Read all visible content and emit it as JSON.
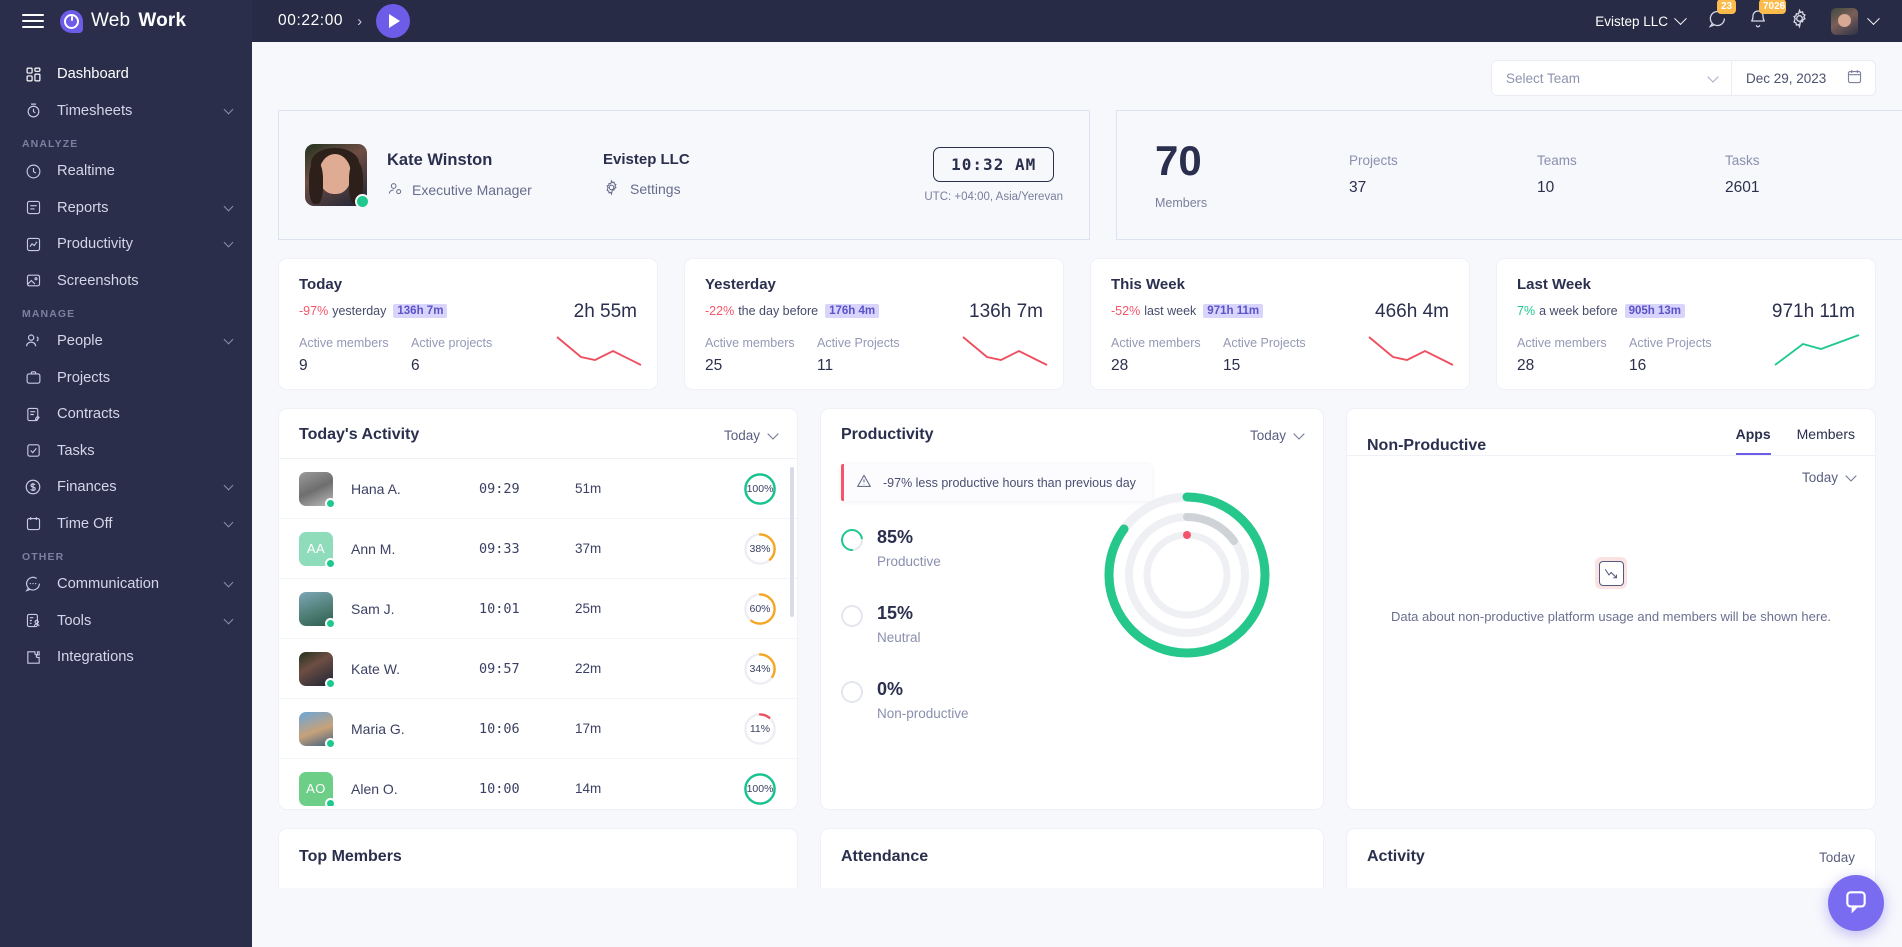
{
  "topbar": {
    "brand_light": "Web",
    "brand_bold": "Work",
    "timer": "00:22:00",
    "arrow": "›",
    "org": "Evistep LLC",
    "chat_badge": "23",
    "bell_badge": "7026"
  },
  "sidebar": {
    "items": [
      {
        "label": "Dashboard",
        "icon": "dashboard-icon",
        "active": true,
        "expandable": false
      },
      {
        "label": "Timesheets",
        "icon": "timesheets-icon",
        "active": false,
        "expandable": true
      },
      {
        "section": "ANALYZE"
      },
      {
        "label": "Realtime",
        "icon": "realtime-icon",
        "active": false,
        "expandable": false
      },
      {
        "label": "Reports",
        "icon": "reports-icon",
        "active": false,
        "expandable": true
      },
      {
        "label": "Productivity",
        "icon": "productivity-icon",
        "active": false,
        "expandable": true
      },
      {
        "label": "Screenshots",
        "icon": "screenshots-icon",
        "active": false,
        "expandable": false
      },
      {
        "section": "MANAGE"
      },
      {
        "label": "People",
        "icon": "people-icon",
        "active": false,
        "expandable": true
      },
      {
        "label": "Projects",
        "icon": "projects-icon",
        "active": false,
        "expandable": false
      },
      {
        "label": "Contracts",
        "icon": "contracts-icon",
        "active": false,
        "expandable": false
      },
      {
        "label": "Tasks",
        "icon": "tasks-icon",
        "active": false,
        "expandable": false
      },
      {
        "label": "Finances",
        "icon": "finances-icon",
        "active": false,
        "expandable": true
      },
      {
        "label": "Time Off",
        "icon": "timeoff-icon",
        "active": false,
        "expandable": true
      },
      {
        "section": "OTHER"
      },
      {
        "label": "Communication",
        "icon": "communication-icon",
        "active": false,
        "expandable": true
      },
      {
        "label": "Tools",
        "icon": "tools-icon",
        "active": false,
        "expandable": true
      },
      {
        "label": "Integrations",
        "icon": "integrations-icon",
        "active": false,
        "expandable": false
      }
    ]
  },
  "filters": {
    "team_placeholder": "Select Team",
    "date": "Dec 29, 2023"
  },
  "profile": {
    "name": "Kate Winston",
    "role": "Executive Manager",
    "org": "Evistep LLC",
    "settings": "Settings",
    "clock": "10:32 AM",
    "timezone": "UTC: +04:00, Asia/Yerevan"
  },
  "stats": {
    "members_value": "70",
    "members_label": "Members",
    "items": [
      {
        "label": "Projects",
        "value": "37"
      },
      {
        "label": "Teams",
        "value": "10"
      },
      {
        "label": "Tasks",
        "value": "2601"
      }
    ]
  },
  "mini_cards": [
    {
      "title": "Today",
      "delta": "-97%",
      "delta_sign": "neg",
      "compare": "yesterday",
      "pill": "136h 7m",
      "total": "2h 55m",
      "members_label": "Active members",
      "members_value": "9",
      "projects_label": "Active projects",
      "projects_value": "6",
      "trend": "down",
      "trend_color": "#ED4F5E"
    },
    {
      "title": "Yesterday",
      "delta": "-22%",
      "delta_sign": "neg",
      "compare": "the day before",
      "pill": "176h 4m",
      "total": "136h 7m",
      "members_label": "Active members",
      "members_value": "25",
      "projects_label": "Active Projects",
      "projects_value": "11",
      "trend": "down",
      "trend_color": "#ED4F5E"
    },
    {
      "title": "This Week",
      "delta": "-52%",
      "delta_sign": "neg",
      "compare": "last week",
      "pill": "971h 11m",
      "total": "466h 4m",
      "members_label": "Active members",
      "members_value": "28",
      "projects_label": "Active Projects",
      "projects_value": "15",
      "trend": "down",
      "trend_color": "#ED4F5E"
    },
    {
      "title": "Last Week",
      "delta": "7%",
      "delta_sign": "pos",
      "compare": "a week before",
      "pill": "905h 13m",
      "total": "971h 11m",
      "members_label": "Active members",
      "members_value": "28",
      "projects_label": "Active Projects",
      "projects_value": "16",
      "trend": "up",
      "trend_color": "#1FC98E"
    }
  ],
  "activity": {
    "title": "Today's Activity",
    "range": "Today",
    "rows": [
      {
        "name": "Hana A.",
        "time": "09:29",
        "duration": "51m",
        "percent": "100%",
        "pct_num": 100,
        "ring_color": "#14C38E",
        "avatar_type": "photo",
        "avatar_css": "linear-gradient(155deg,#9b9b9b 0%,#6e6e6e 50%,#bdbdbd 100%)",
        "initials": ""
      },
      {
        "name": "Ann M.",
        "time": "09:33",
        "duration": "37m",
        "percent": "38%",
        "pct_num": 38,
        "ring_color": "#F5A623",
        "avatar_type": "initials",
        "avatar_css": "#8FDCBB",
        "initials": "AA"
      },
      {
        "name": "Sam J.",
        "time": "10:01",
        "duration": "25m",
        "percent": "60%",
        "pct_num": 60,
        "ring_color": "#F5A623",
        "avatar_type": "photo",
        "avatar_css": "linear-gradient(160deg,#7ea6b8 0%,#4f7f76 55%,#2f5d4e 100%)",
        "initials": ""
      },
      {
        "name": "Kate W.",
        "time": "09:57",
        "duration": "22m",
        "percent": "34%",
        "pct_num": 34,
        "ring_color": "#F5A623",
        "avatar_type": "photo",
        "avatar_css": "linear-gradient(150deg,#23331f 0%,#6e4e43 40%,#1d2436 100%)",
        "initials": ""
      },
      {
        "name": "Maria G.",
        "time": "10:06",
        "duration": "17m",
        "percent": "11%",
        "pct_num": 11,
        "ring_color": "#ED4F5E",
        "avatar_type": "photo",
        "avatar_css": "linear-gradient(160deg,#6aa6d8 0%,#c7a27a 55%,#3f5f7f 100%)",
        "initials": ""
      },
      {
        "name": "Alen O.",
        "time": "10:00",
        "duration": "14m",
        "percent": "100%",
        "pct_num": 100,
        "ring_color": "#14C38E",
        "avatar_type": "initials",
        "avatar_css": "#6CCE87",
        "initials": "AO"
      }
    ]
  },
  "productivity": {
    "title": "Productivity",
    "range": "Today",
    "alert": "-97% less productive hours than previous day",
    "legend": [
      {
        "pct": "85%",
        "label": "Productive",
        "color": "#1FC98E"
      },
      {
        "pct": "15%",
        "label": "Neutral",
        "color": "#E4E6EE"
      },
      {
        "pct": "0%",
        "label": "Non-productive",
        "color": "#E4E6EE"
      }
    ]
  },
  "non_productive": {
    "title": "Non-Productive",
    "tabs": [
      {
        "label": "Apps",
        "active": true
      },
      {
        "label": "Members",
        "active": false
      }
    ],
    "range": "Today",
    "empty_text": "Data about non-productive platform usage and members will be shown here."
  },
  "bottom_panels": [
    {
      "title": "Top Members",
      "range": ""
    },
    {
      "title": "Attendance",
      "range": ""
    },
    {
      "title": "Activity",
      "range": "Today"
    }
  ],
  "chart_data": {
    "type": "pie",
    "title": "Productivity",
    "categories": [
      "Productive",
      "Neutral",
      "Non-productive"
    ],
    "values": [
      85,
      15,
      0
    ],
    "colors": [
      "#1FC98E",
      "#E4E6EE",
      "#E4E6EE"
    ],
    "legend_position": "left"
  }
}
